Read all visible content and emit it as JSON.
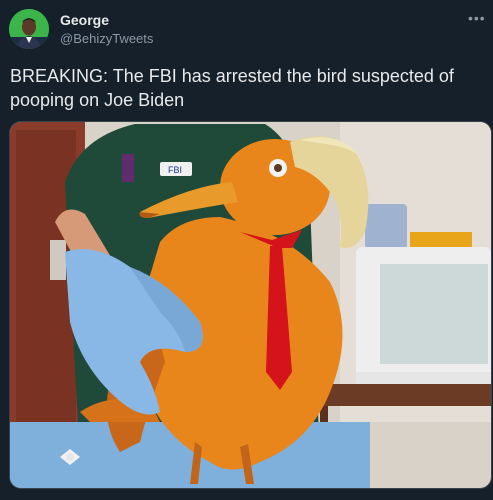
{
  "tweet": {
    "author_name": "George",
    "author_handle": "@BehizyTweets",
    "more_icon": "more-options-icon",
    "text": "BREAKING: The FBI has arrested the bird suspected of pooping on Joe Biden",
    "image": {
      "badge_text": "FBI"
    }
  },
  "colors": {
    "background": "#15202b",
    "primary_text": "#e7e9ea",
    "secondary_text": "#8b98a5",
    "bird_orange": "#e8861c",
    "tie_red": "#d4141a",
    "glove_blue": "#8ab8e6"
  }
}
